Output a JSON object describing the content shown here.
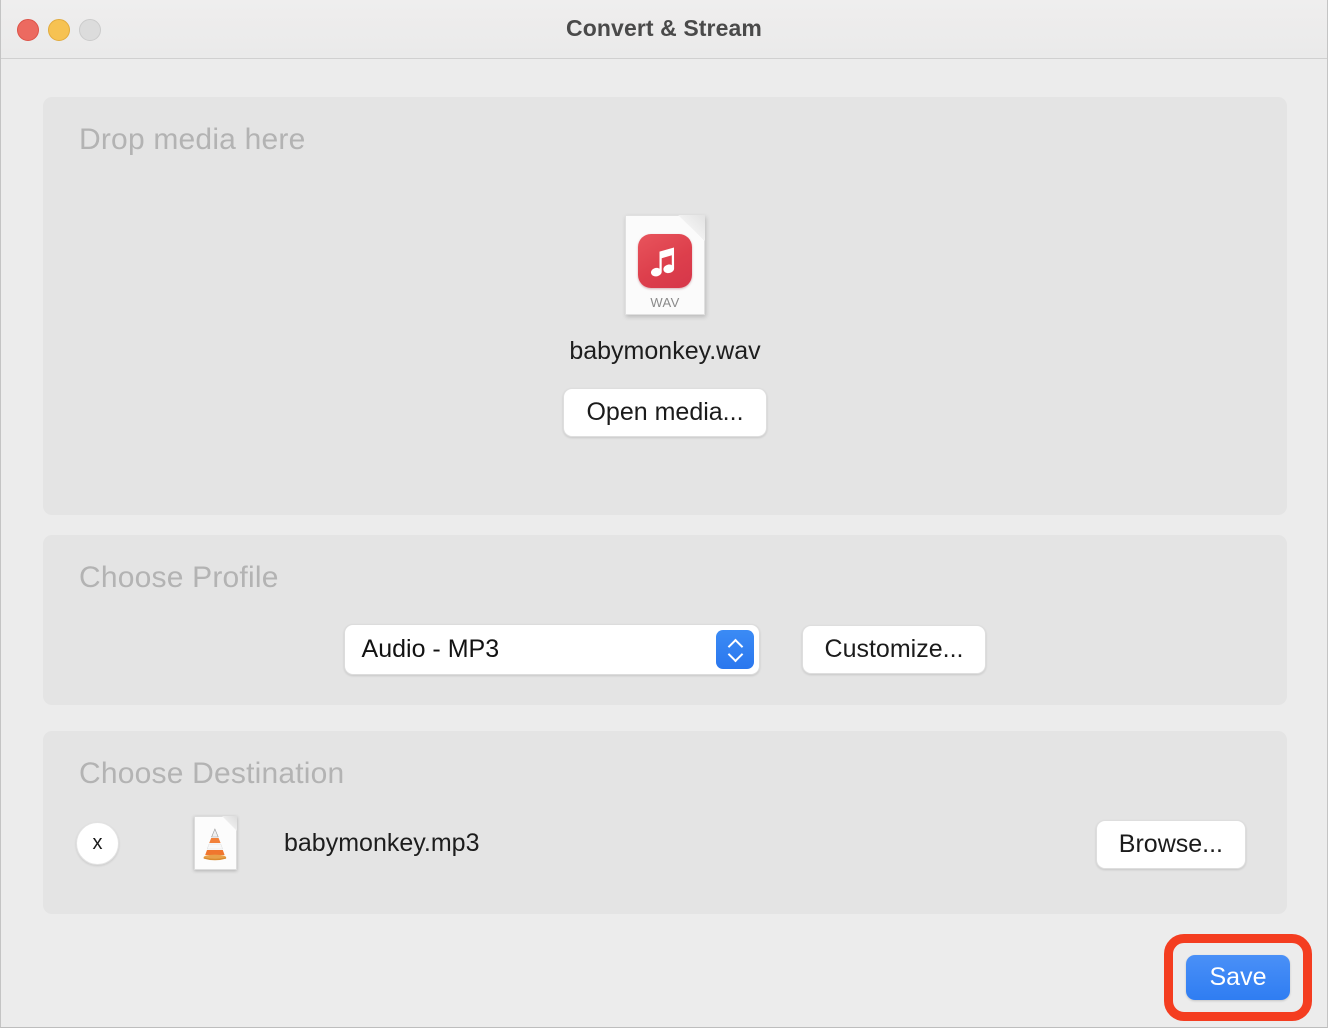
{
  "window": {
    "title": "Convert & Stream",
    "traffic_lights": [
      {
        "name": "close",
        "color": "#ec6a60"
      },
      {
        "name": "minimize",
        "color": "#f6c252"
      },
      {
        "name": "zoom",
        "color": "#dcdcdc"
      }
    ]
  },
  "drop_zone": {
    "title": "Drop media here",
    "file": {
      "name": "babymonkey.wav",
      "icon": "wav-audio-file-icon",
      "extension_label": "WAV",
      "badge_color": "#dd3f4c"
    },
    "open_media_label": "Open media..."
  },
  "profile": {
    "title": "Choose Profile",
    "selected": "Audio - MP3",
    "options": [
      "Audio - MP3"
    ],
    "stepper_color": "#2f7df2",
    "customize_label": "Customize..."
  },
  "destination": {
    "title": "Choose Destination",
    "remove_label": "x",
    "file": {
      "name": "babymonkey.mp3",
      "icon": "vlc-cone-file-icon"
    },
    "browse_label": "Browse..."
  },
  "footer": {
    "save_label": "Save",
    "save_color": "#2f7df2",
    "highlight_color": "#f43d20"
  }
}
